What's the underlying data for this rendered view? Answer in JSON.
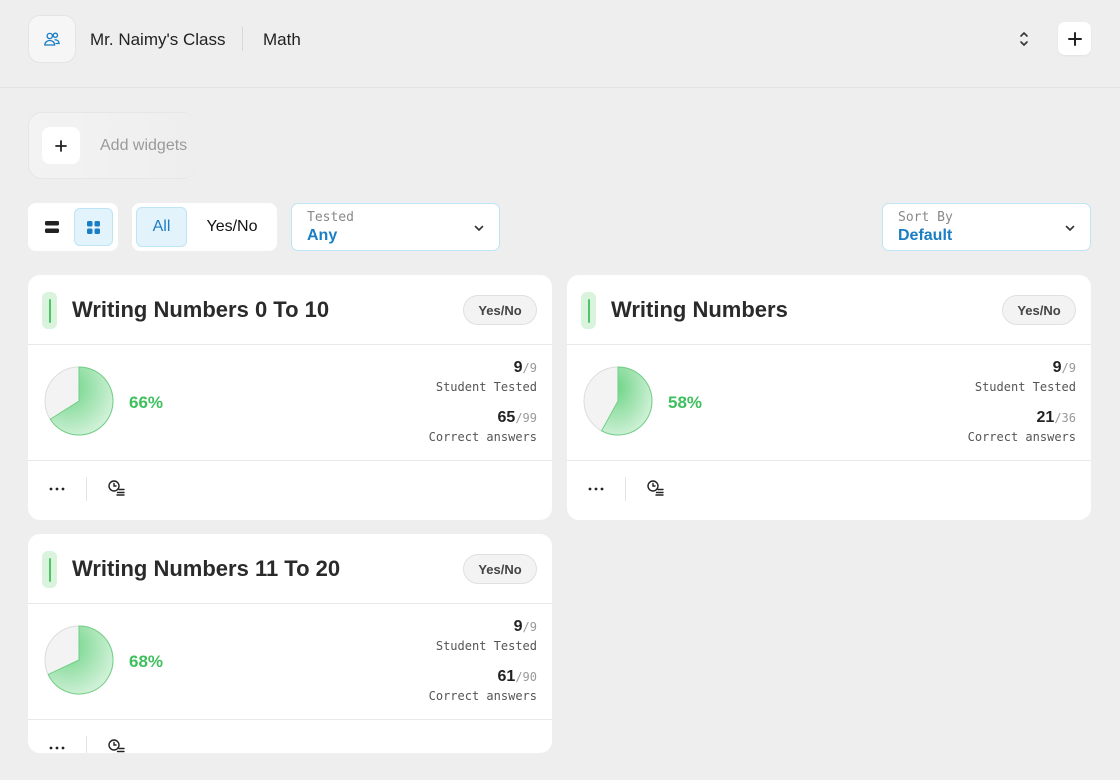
{
  "header": {
    "class_icon": "users-icon",
    "class_name": "Mr. Naimy's Class",
    "subject": "Math",
    "sort_icon": "up-down-chevron-icon",
    "add_icon": "plus-icon"
  },
  "widgets": {
    "add_icon": "plus-icon",
    "label": "Add widgets"
  },
  "filters": {
    "view_list_icon": "list-view-icon",
    "view_grid_icon": "grid-view-icon",
    "view_selected": "grid",
    "type_options": [
      "All",
      "Yes/No"
    ],
    "type_selected": "All",
    "tested": {
      "label": "Tested",
      "value": "Any"
    },
    "sort": {
      "label": "Sort By",
      "value": "Default"
    }
  },
  "colors": {
    "accent_blue": "#1a7ec4",
    "success_green": "#3fbf5d",
    "pie_fill": "#a9e3b6",
    "pie_bg": "#f3f3f3"
  },
  "cards": [
    {
      "title": "Writing Numbers 0 To 10",
      "badge": "Yes/No",
      "percent_label": "66%",
      "percent_value": 66,
      "students_tested": "9",
      "students_total": "/9",
      "students_label": "Student Tested",
      "correct": "65",
      "correct_total": "/99",
      "correct_label": "Correct answers"
    },
    {
      "title": "Writing Numbers",
      "badge": "Yes/No",
      "percent_label": "58%",
      "percent_value": 58,
      "students_tested": "9",
      "students_total": "/9",
      "students_label": "Student Tested",
      "correct": "21",
      "correct_total": "/36",
      "correct_label": "Correct answers"
    },
    {
      "title": "Writing Numbers 11 To 20",
      "badge": "Yes/No",
      "percent_label": "68%",
      "percent_value": 68,
      "students_tested": "9",
      "students_total": "/9",
      "students_label": "Student Tested",
      "correct": "61",
      "correct_total": "/90",
      "correct_label": "Correct answers"
    }
  ]
}
